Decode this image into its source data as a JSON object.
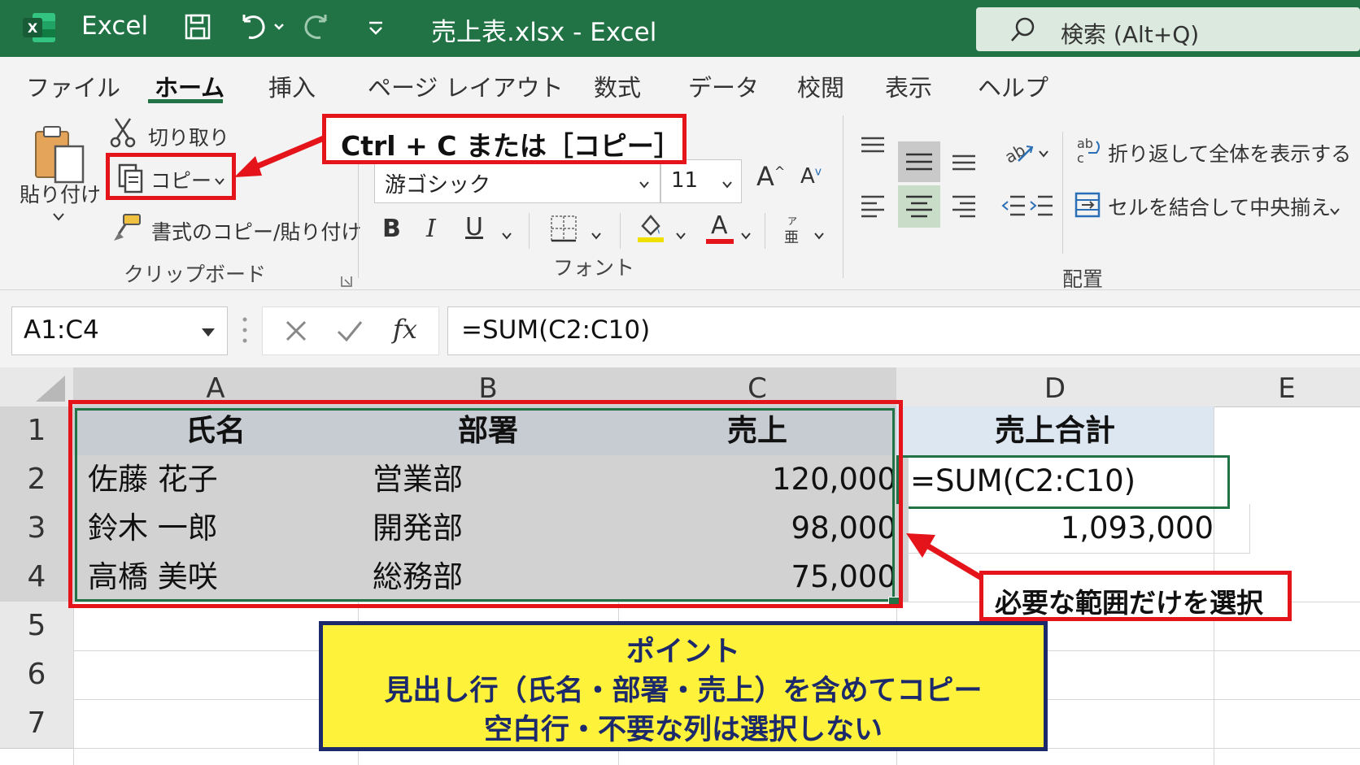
{
  "titlebar": {
    "app_name": "Excel",
    "doc_title": "売上表.xlsx  -  Excel",
    "search_placeholder": "検索 (Alt+Q)"
  },
  "ribbon_tabs": [
    "ファイル",
    "ホーム",
    "挿入",
    "ページ レイアウト",
    "数式",
    "データ",
    "校閲",
    "表示",
    "ヘルプ"
  ],
  "clipboard": {
    "paste_label": "貼り付け",
    "cut_label": "切り取り",
    "copy_label": "コピー",
    "format_painter_label": "書式のコピー/貼り付け",
    "group_label": "クリップボード"
  },
  "font": {
    "font_name": "游ゴシック",
    "font_size": "11",
    "group_label": "フォント",
    "bold": "B",
    "italic": "I",
    "underline": "U",
    "font_color_letter": "A"
  },
  "alignment": {
    "wrap_text": "折り返して全体を表示する",
    "merge_center": "セルを結合して中央揃え",
    "group_label": "配置"
  },
  "formula_bar": {
    "name_box": "A1:C4",
    "formula": "=SUM(C2:C10)",
    "fx": "fx"
  },
  "grid": {
    "columns": [
      "A",
      "B",
      "C",
      "D",
      "E"
    ],
    "rows": [
      "1",
      "2",
      "3",
      "4",
      "5",
      "6",
      "7"
    ],
    "headers": [
      "氏名",
      "部署",
      "売上"
    ],
    "data": [
      [
        "佐藤 花子",
        "営業部",
        "120,000"
      ],
      [
        "鈴木 一郎",
        "開発部",
        "98,000"
      ],
      [
        "高橋 美咲",
        "総務部",
        "75,000"
      ]
    ],
    "d1": "売上合計",
    "d2": "=SUM(C2:C10)",
    "d3": "1,093,000"
  },
  "callouts": {
    "copy_hint": "Ctrl + C または［コピー］",
    "select_hint": "必要な範囲だけを選択",
    "point_title": "ポイント",
    "point_line1": "見出し行（氏名・部署・売上）を含めてコピー",
    "point_line2": "空白行・不要な列は選択しない"
  },
  "colors": {
    "excel_green": "#217346",
    "callout_red": "#e5141b",
    "point_yellow": "#fff23a",
    "point_border": "#1c2a6b"
  }
}
